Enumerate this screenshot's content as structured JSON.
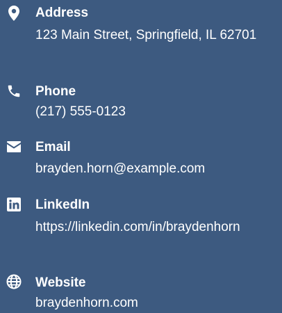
{
  "contact": {
    "items": [
      {
        "icon": "map-marker-icon",
        "label": "Address",
        "value": "123 Main Street, Springfield, IL 62701"
      },
      {
        "icon": "phone-icon",
        "label": "Phone",
        "value": "(217) 555-0123"
      },
      {
        "icon": "envelope-icon",
        "label": "Email",
        "value": "brayden.horn@example.com"
      },
      {
        "icon": "linkedin-icon",
        "label": "LinkedIn",
        "value": "https://linkedin.com/in/braydenhorn"
      },
      {
        "icon": "globe-icon",
        "label": "Website",
        "value": "braydenhorn.com"
      }
    ]
  },
  "colors": {
    "background": "#3d5a80",
    "text": "#ffffff"
  }
}
